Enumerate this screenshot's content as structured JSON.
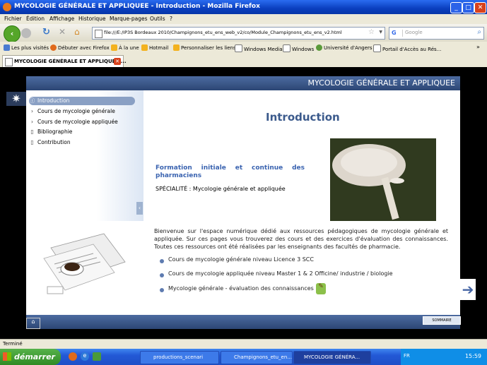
{
  "window": {
    "title": "MYCOLOGIE GÉNÉRALE ET APPLIQUEE - Introduction - Mozilla Firefox"
  },
  "menu": [
    "Fichier",
    "Édition",
    "Affichage",
    "Historique",
    "Marque-pages",
    "Outils",
    "?"
  ],
  "navbar": {
    "url": "file:///E:/IP3S Bordeaux 2010/Champignons_etu_ens_web_v2/co/Module_Champignons_etu_ens_v2.html",
    "search_placeholder": "Google"
  },
  "bookmarks": [
    {
      "label": "Les plus visités",
      "color": "#4a7bd1"
    },
    {
      "label": "Débuter avec Firefox",
      "color": "#e06a1b"
    },
    {
      "label": "À la une",
      "color": "#f3b21f"
    },
    {
      "label": "Hotmail",
      "color": "#f3b21f"
    },
    {
      "label": "Personnaliser les liens",
      "color": "#f3b21f"
    },
    {
      "label": "Windows Media",
      "color": "#ffffff"
    },
    {
      "label": "Windows",
      "color": "#ffffff"
    },
    {
      "label": "Université d'Angers",
      "color": "#5a9a3a"
    },
    {
      "label": "Portail d'Accès au Rés...",
      "color": "#ffffff"
    }
  ],
  "tab": {
    "label": "MYCOLOGIE GÉNÉRALE ET APPLIQUEE ..."
  },
  "page": {
    "header_title": "MYCOLOGIE GÉNÉRALE ET APPLIQUEE",
    "menu_items": [
      {
        "label": "Introduction",
        "icon": "info-icon",
        "active": true
      },
      {
        "label": "Cours de mycologie générale",
        "icon": "chevron-right-icon",
        "active": false
      },
      {
        "label": "Cours de mycologie appliquée",
        "icon": "chevron-right-icon",
        "active": false
      },
      {
        "label": "Bibliographie",
        "icon": "document-icon",
        "active": false
      },
      {
        "label": "Contribution",
        "icon": "document-icon",
        "active": false
      }
    ],
    "intro_title": "Introduction",
    "formation": "Formation initiale et continue des pharmaciens",
    "specialite": "SPÉCIALITÉ : Mycologie générale et appliquée",
    "welcome": "Bienvenue sur l'espace numérique dédié aux ressources pédagogiques de mycologie générale et appliquée. Sur ces pages vous trouverez des cours et des exercices d'évaluation des connaissances. Toutes ces ressources ont été réalisées par les enseignants des facultés de pharmacie.",
    "courses": [
      "Cours de mycologie générale niveau Licence 3 SCC",
      "Cours de mycologie appliquée niveau Master 1 & 2 Officine/ industrie / biologie",
      "Mycologie générale - évaluation des connaissances"
    ],
    "sommaire_label": "SOMMAIRE"
  },
  "status": {
    "text": "Terminé"
  },
  "taskbar": {
    "start_label": "démarrer",
    "tasks": [
      {
        "label": "productions_scenari",
        "active": false
      },
      {
        "label": "Champignons_etu_en...",
        "active": false
      },
      {
        "label": "MYCOLOGIE GÉNÉRA...",
        "active": true
      }
    ],
    "lang": "FR",
    "time": "15:59"
  }
}
